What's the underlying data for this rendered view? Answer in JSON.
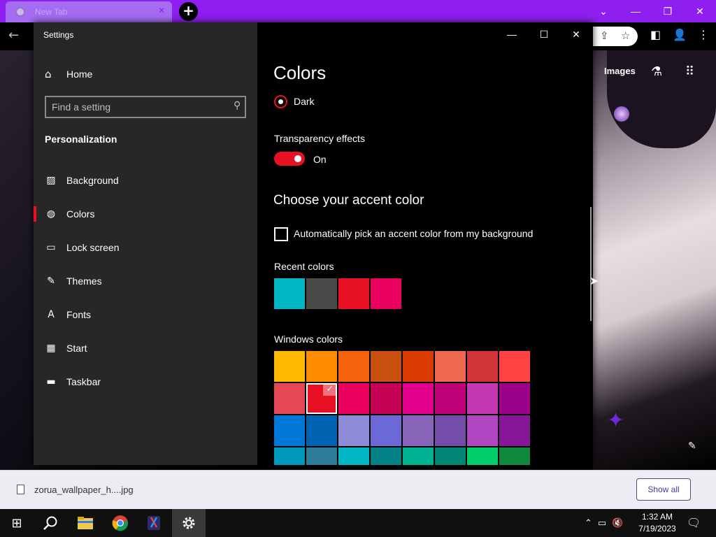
{
  "browser": {
    "tab_title": "New Tab",
    "images_link": "Images",
    "window_controls": {
      "chevron": "⌄",
      "minimize": "—",
      "restore": "❐",
      "close": "✕"
    }
  },
  "settings": {
    "window_title": "Settings",
    "controls": {
      "minimize": "—",
      "maximize": "☐",
      "close": "✕"
    },
    "nav": {
      "home": "Home",
      "search_placeholder": "Find a setting",
      "section": "Personalization",
      "items": [
        {
          "label": "Background",
          "icon": "image-icon"
        },
        {
          "label": "Colors",
          "icon": "palette-icon",
          "selected": true
        },
        {
          "label": "Lock screen",
          "icon": "lock-screen-icon"
        },
        {
          "label": "Themes",
          "icon": "themes-icon"
        },
        {
          "label": "Fonts",
          "icon": "fonts-icon"
        },
        {
          "label": "Start",
          "icon": "start-icon"
        },
        {
          "label": "Taskbar",
          "icon": "taskbar-icon"
        }
      ]
    },
    "content": {
      "title": "Colors",
      "mode_option": "Dark",
      "transparency_label": "Transparency effects",
      "transparency_state": "On",
      "accent_heading": "Choose your accent color",
      "auto_accent_label": "Automatically pick an accent color from my background",
      "recent_label": "Recent colors",
      "recent_colors": [
        "#00b7c3",
        "#4c4a48",
        "#e81123",
        "#ea005e"
      ],
      "windows_label": "Windows colors",
      "windows_colors": [
        [
          "#ffb900",
          "#ff8c00",
          "#f7630c",
          "#ca5010",
          "#da3b01",
          "#ef6950",
          "#d13438",
          "#ff4343"
        ],
        [
          "#e74856",
          "#e81123",
          "#ea005e",
          "#c30052",
          "#e3008c",
          "#bf0077",
          "#c239b3",
          "#9a0089"
        ],
        [
          "#0078d7",
          "#0063b1",
          "#8e8cd8",
          "#6b69d6",
          "#8764b8",
          "#744da9",
          "#b146c2",
          "#881798"
        ],
        [
          "#0099bc",
          "#2d7d9a",
          "#00b7c3",
          "#038387",
          "#00b294",
          "#018574",
          "#00cc6a",
          "#10893e"
        ]
      ],
      "selected_color": "#e81123"
    }
  },
  "downloads": {
    "file_name": "zorua_wallpaper_h....jpg",
    "show_all": "Show all"
  },
  "taskbar": {
    "time": "1:32 AM",
    "date": "7/19/2023"
  },
  "colors": {
    "accent": "#e81123",
    "tab_bar": "#8f1ff0",
    "nav_background": "#272727"
  }
}
